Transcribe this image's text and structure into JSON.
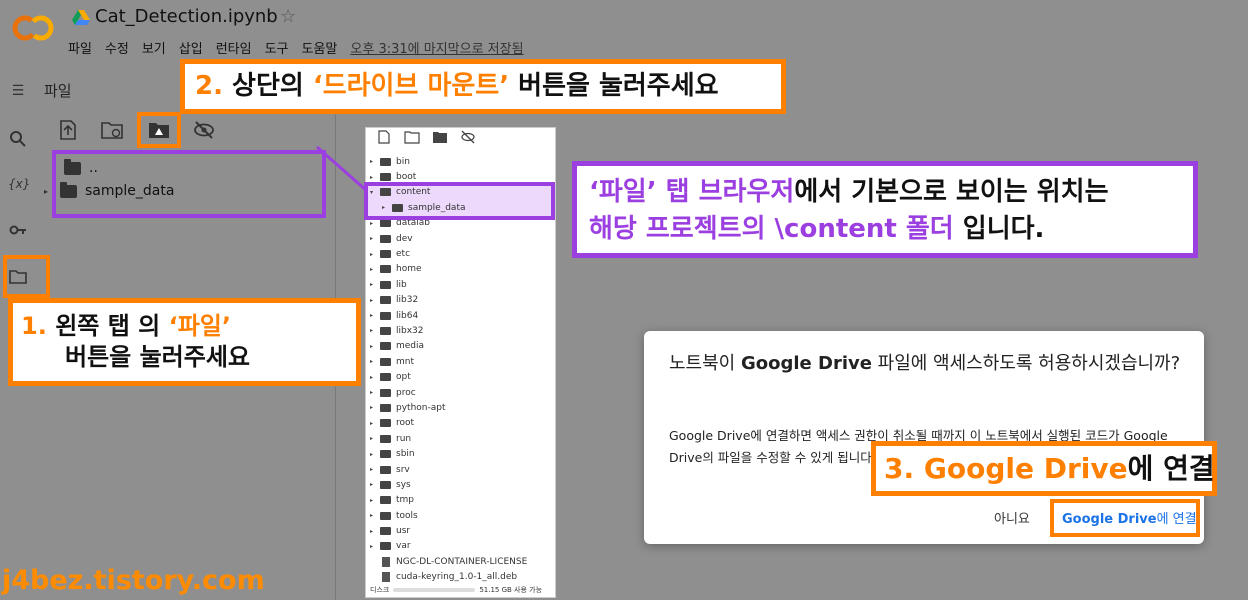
{
  "header": {
    "notebook_title": "Cat_Detection.ipynb",
    "menu": [
      "파일",
      "수정",
      "보기",
      "삽입",
      "런타임",
      "도구",
      "도움말"
    ],
    "saved_status": "오후 3:31에 마지막으로 저장됨"
  },
  "panel": {
    "title": "파일",
    "tree": [
      {
        "label": ".."
      },
      {
        "label": "sample_data"
      }
    ]
  },
  "file_browser": {
    "items": [
      {
        "label": "bin",
        "kind": "folder"
      },
      {
        "label": "boot",
        "kind": "folder"
      },
      {
        "label": "content",
        "kind": "folder",
        "expanded": true
      },
      {
        "label": "sample_data",
        "kind": "folder",
        "child": true
      },
      {
        "label": "datalab",
        "kind": "folder"
      },
      {
        "label": "dev",
        "kind": "folder"
      },
      {
        "label": "etc",
        "kind": "folder"
      },
      {
        "label": "home",
        "kind": "folder"
      },
      {
        "label": "lib",
        "kind": "folder"
      },
      {
        "label": "lib32",
        "kind": "folder"
      },
      {
        "label": "lib64",
        "kind": "folder"
      },
      {
        "label": "libx32",
        "kind": "folder"
      },
      {
        "label": "media",
        "kind": "folder"
      },
      {
        "label": "mnt",
        "kind": "folder"
      },
      {
        "label": "opt",
        "kind": "folder"
      },
      {
        "label": "proc",
        "kind": "folder"
      },
      {
        "label": "python-apt",
        "kind": "folder"
      },
      {
        "label": "root",
        "kind": "folder"
      },
      {
        "label": "run",
        "kind": "folder"
      },
      {
        "label": "sbin",
        "kind": "folder"
      },
      {
        "label": "srv",
        "kind": "folder"
      },
      {
        "label": "sys",
        "kind": "folder"
      },
      {
        "label": "tmp",
        "kind": "folder"
      },
      {
        "label": "tools",
        "kind": "folder"
      },
      {
        "label": "usr",
        "kind": "folder"
      },
      {
        "label": "var",
        "kind": "folder"
      },
      {
        "label": "NGC-DL-CONTAINER-LICENSE",
        "kind": "file"
      },
      {
        "label": "cuda-keyring_1.0-1_all.deb",
        "kind": "file"
      }
    ],
    "disk_label": "디스크",
    "disk_usage": "51.15 GB 사용 가능"
  },
  "dialog": {
    "title_pre": "노트북이 ",
    "title_bold": "Google Drive",
    "title_post": " 파일에 액세스하도록 허용하시겠습니까?",
    "body": "Google Drive에 연결하면 액세스 권한이 취소될 때까지 이 노트북에서 실행된 코드가 Google Drive의 파일을 수정할 수 있게 됩니다.",
    "cancel_label": "아니요",
    "connect_bold": "Google Drive",
    "connect_rest": "에 연결"
  },
  "annotations": {
    "a1_num": "1.",
    "a1_text": "왼쪽 탭 의 ",
    "a1_highlight": "‘파일’",
    "a1_line2": "버튼을 눌러주세요",
    "a2_num": "2.",
    "a2_text1": "상단의 ",
    "a2_highlight": "‘드라이브 마운트’",
    "a2_text2": " 버튼을 눌러주세요",
    "a3_highlight1": "‘파일’ 탭 브라우저",
    "a3_text1": "에서 기본으로 보이는 위치는",
    "a3_highlight2": "해당 프로젝트의 \\content 폴더",
    "a3_text2": " 입니다.",
    "a4_text": "3. Google Drive",
    "a4_suffix": "에 연결"
  },
  "watermark": "j4bez.tistory.com",
  "colors": {
    "accent_orange": "#ff7f00",
    "accent_purple": "#9b3fe0",
    "link_blue": "#1a73e8"
  }
}
